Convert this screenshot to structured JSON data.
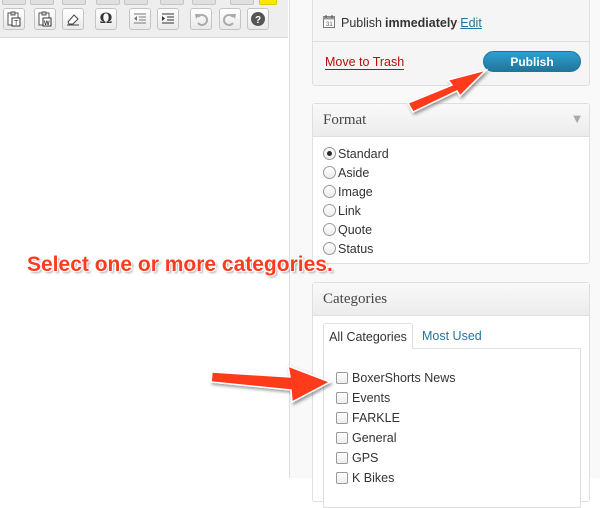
{
  "toolbar": {
    "buttons": [
      {
        "name": "paste-as-text-icon"
      },
      {
        "name": "paste-from-word-icon"
      },
      {
        "name": "remove-formatting-icon"
      },
      {
        "name": "special-character-icon",
        "glyph": "Ω"
      },
      {
        "name": "outdent-icon"
      },
      {
        "name": "indent-icon"
      },
      {
        "name": "undo-icon"
      },
      {
        "name": "redo-icon"
      },
      {
        "name": "help-icon"
      }
    ]
  },
  "publish": {
    "label": "Publish",
    "timing": "immediately",
    "edit_link": "Edit",
    "trash_link": "Move to Trash",
    "button_label": "Publish"
  },
  "format": {
    "title": "Format",
    "options": [
      {
        "label": "Standard",
        "checked": true
      },
      {
        "label": "Aside",
        "checked": false
      },
      {
        "label": "Image",
        "checked": false
      },
      {
        "label": "Link",
        "checked": false
      },
      {
        "label": "Quote",
        "checked": false
      },
      {
        "label": "Status",
        "checked": false
      }
    ]
  },
  "categories": {
    "title": "Categories",
    "tabs": [
      "All Categories",
      "Most Used"
    ],
    "items": [
      "BoxerShorts News",
      "Events",
      "FARKLE",
      "General",
      "GPS",
      "K Bikes"
    ]
  },
  "annotation": {
    "callout": "Select one or more categories."
  },
  "colors": {
    "accent": "#21759b",
    "trash": "#bc0b0b",
    "annotation": "#ff3b1f"
  }
}
